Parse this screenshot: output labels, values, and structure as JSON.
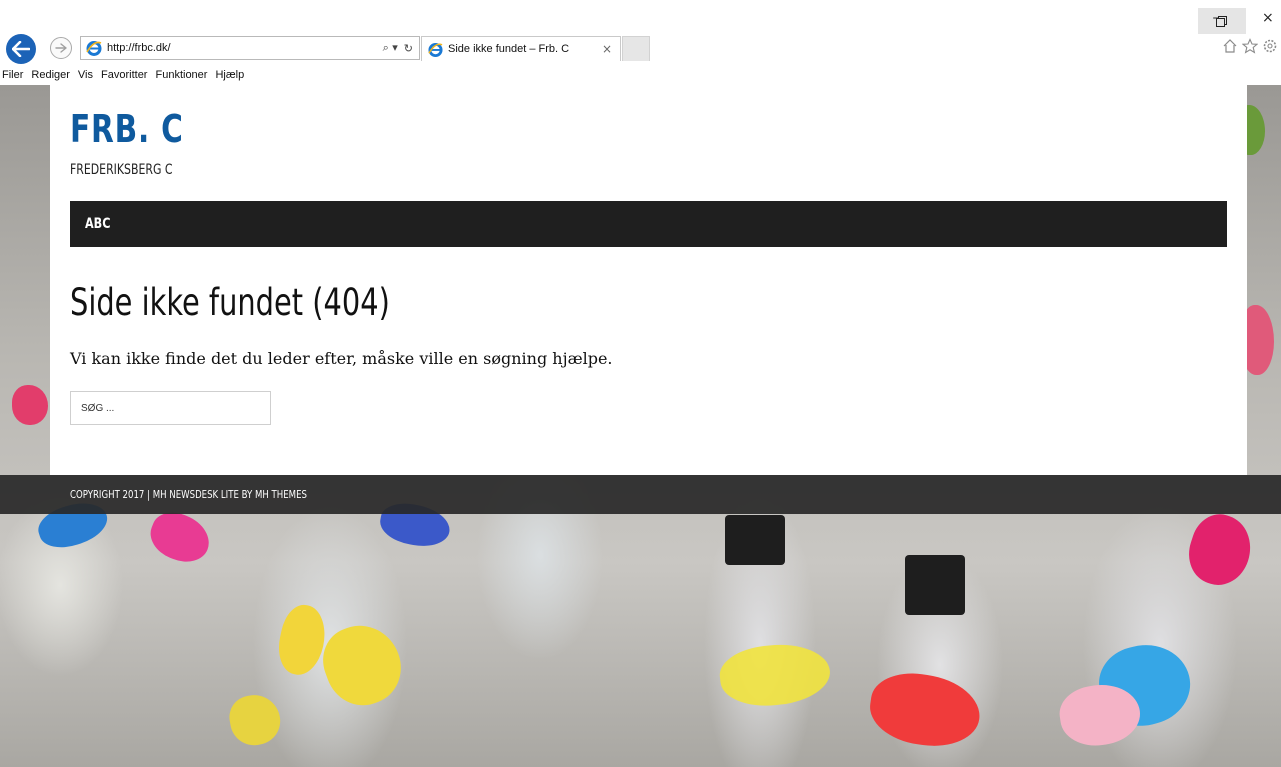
{
  "browser": {
    "url": "http://frbc.dk/",
    "tab_title": "Side ikke fundet – Frb. C",
    "tab_close": "×",
    "search_glyph": "⌕ ▾",
    "refresh_glyph": "↻",
    "window_min": "–",
    "window_close": "×"
  },
  "menu": {
    "items": [
      "Filer",
      "Rediger",
      "Vis",
      "Favoritter",
      "Funktioner",
      "Hjælp"
    ]
  },
  "site": {
    "title": "FRB. C",
    "description": "FREDERIKSBERG C",
    "nav": [
      "ABC"
    ]
  },
  "content": {
    "heading": "Side ikke fundet (404)",
    "message": "Vi kan ikke finde det du leder efter, måske ville en søgning hjælpe.",
    "search_placeholder": "SØG ..."
  },
  "footer": {
    "copyright": "COPYRIGHT 2017 | MH NEWSDESK LITE BY MH THEMES"
  },
  "colors": {
    "brand": "#0f5a9e",
    "nav_bg": "#1f1f1f",
    "footer_bg": "#282828",
    "ie_back": "#1c63b7"
  }
}
